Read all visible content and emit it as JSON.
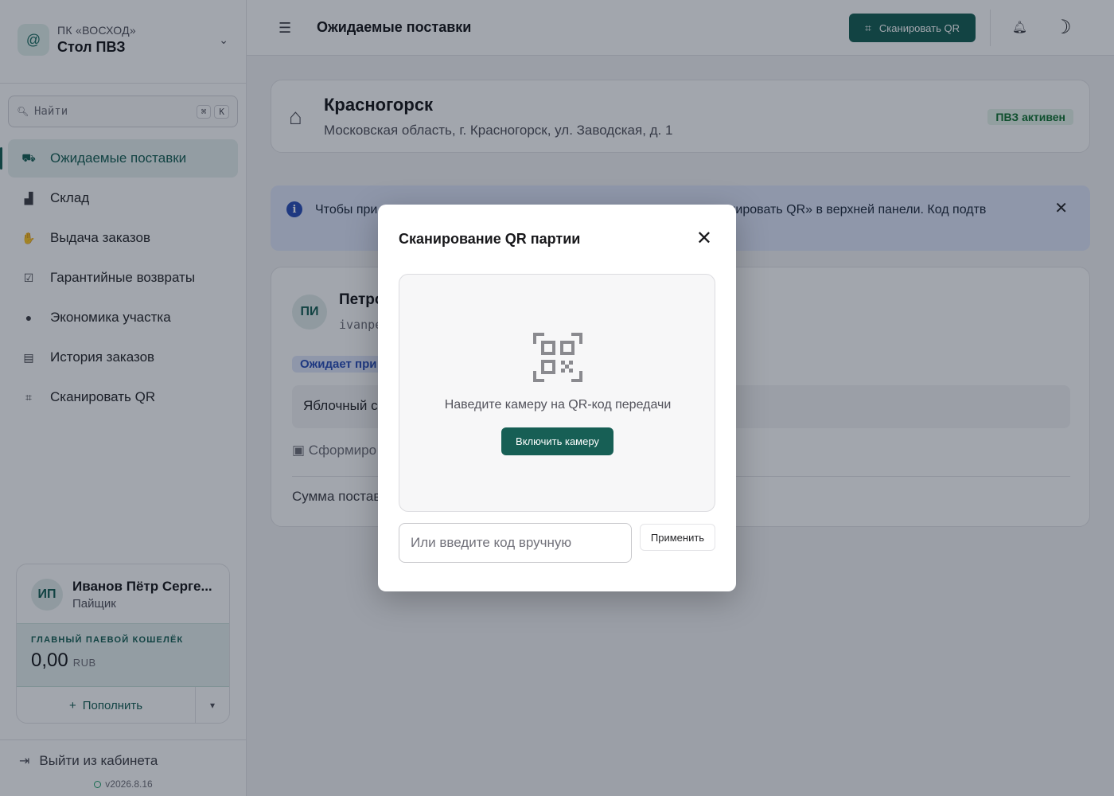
{
  "sidebar": {
    "org": {
      "name": "ПК «ВОСХОД»",
      "place": "Стол ПВЗ"
    },
    "search": {
      "placeholder": "Найти",
      "shortcut_mod": "⌘",
      "shortcut_key": "K"
    },
    "items": [
      {
        "label": "Ожидаемые поставки",
        "icon": "truck-icon",
        "active": true
      },
      {
        "label": "Склад",
        "icon": "boxes-icon"
      },
      {
        "label": "Выдача заказов",
        "icon": "handshake-icon"
      },
      {
        "label": "Гарантийные возвраты",
        "icon": "clipboard-check-icon"
      },
      {
        "label": "Экономика участка",
        "icon": "piggy-bank-icon"
      },
      {
        "label": "История заказов",
        "icon": "receipt-icon"
      },
      {
        "label": "Сканировать QR",
        "icon": "qr-scan-icon"
      }
    ],
    "user": {
      "initials": "ИП",
      "name": "Иванов Пётр Серге...",
      "role": "Пайщик",
      "wallet_label": "ГЛАВНЫЙ ПАЕВОЙ КОШЕЛЁК",
      "wallet_value": "0,00",
      "wallet_currency": "RUB",
      "topup_label": "Пополнить"
    },
    "logout_label": "Выйти из кабинета",
    "version": "v2026.8.16"
  },
  "header": {
    "title": "Ожидаемые поставки",
    "scan_button": "Сканировать QR"
  },
  "location": {
    "city": "Красногорск",
    "address": "Московская область, г. Красногорск, ул. Заводская, д. 1",
    "status": "ПВЗ активен"
  },
  "banner": {
    "text": "Чтобы при                                              QR                               опка «Сканировать QR» в верхней панели. Код подтв"
  },
  "order": {
    "initials": "ПИ",
    "name": "Петро",
    "login": "ivanpe",
    "status": "Ожидает при",
    "item": "Яблочный с",
    "formed": "Сформиро",
    "sum": "Сумма постав"
  },
  "modal": {
    "title": "Сканирование QR партии",
    "hint": "Наведите камеру на QR-код передачи",
    "camera_button": "Включить камеру",
    "manual_placeholder": "Или введите код вручную",
    "manual_value": "",
    "apply_button": "Применить"
  },
  "colors": {
    "accent": "#175f55",
    "info": "#2c4fb8",
    "success": "#137333"
  }
}
